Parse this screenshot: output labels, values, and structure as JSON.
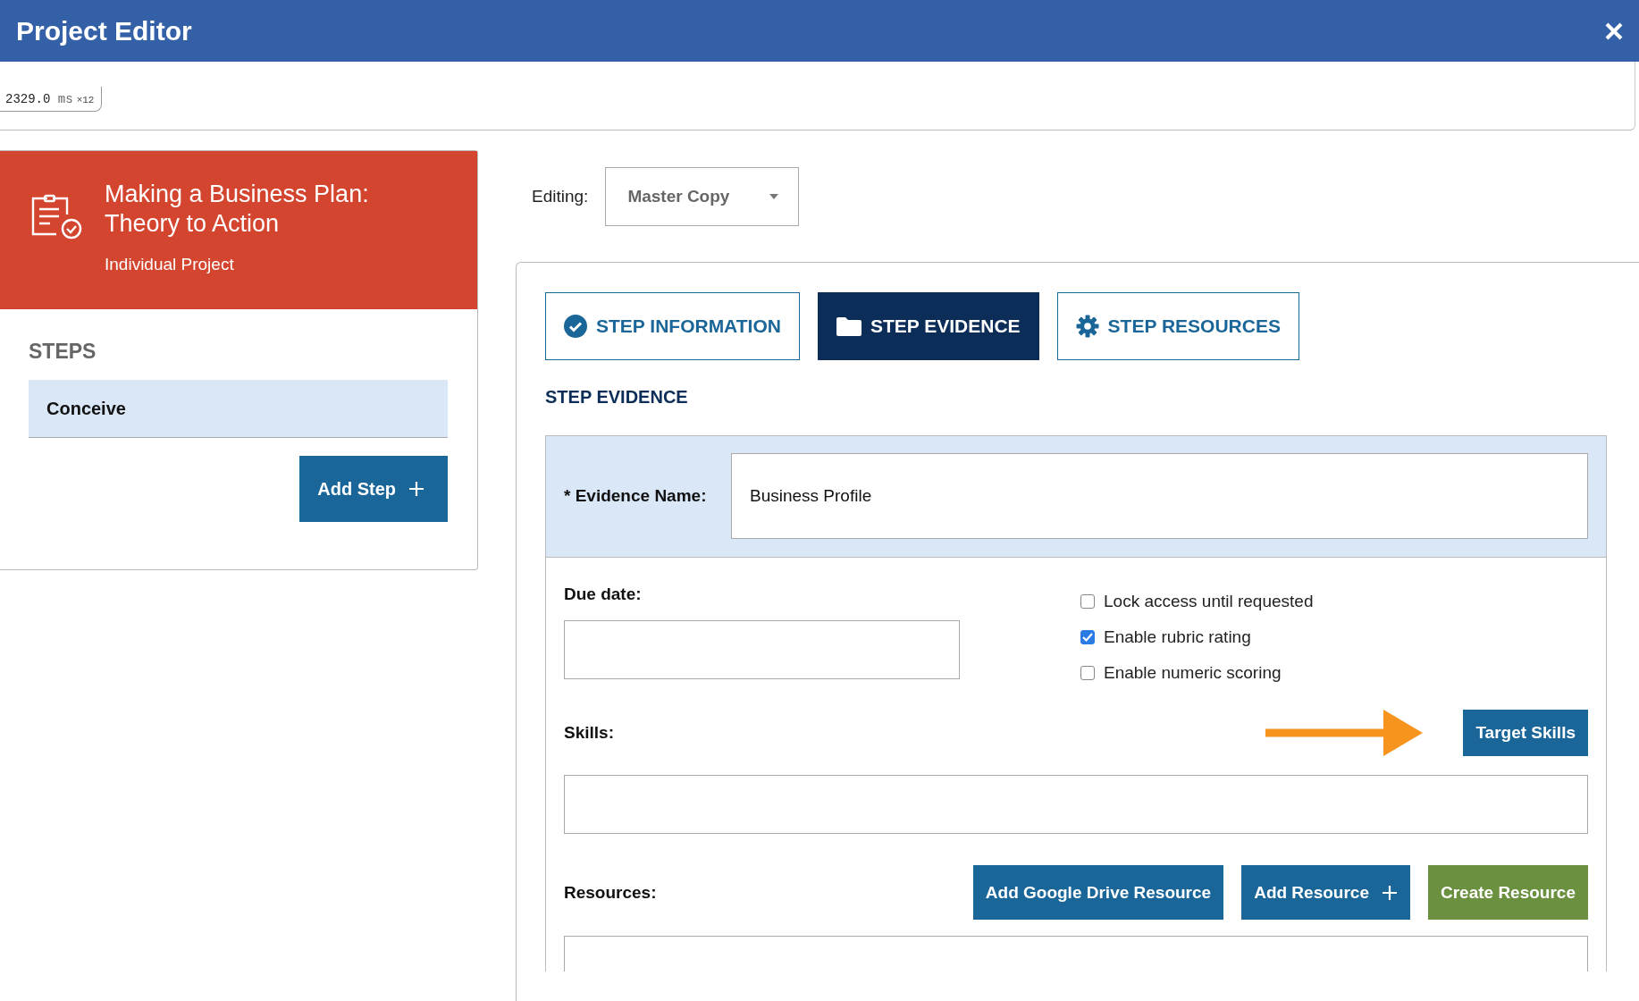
{
  "window": {
    "title": "Project Editor"
  },
  "timing": {
    "value": "2329.0",
    "unit": "ms",
    "count": "×12"
  },
  "project": {
    "title_line1": "Making a Business Plan:",
    "title_line2": "Theory to Action",
    "type": "Individual Project"
  },
  "steps": {
    "heading": "STEPS",
    "items": [
      {
        "label": "Conceive",
        "selected": true
      }
    ],
    "add_button": "Add Step"
  },
  "editing": {
    "label": "Editing:",
    "value": "Master Copy"
  },
  "tabs": [
    {
      "label": "STEP INFORMATION",
      "kind": "check",
      "selected": false
    },
    {
      "label": "STEP EVIDENCE",
      "kind": "folder",
      "selected": true
    },
    {
      "label": "STEP RESOURCES",
      "kind": "gear",
      "selected": false
    }
  ],
  "section_title": "STEP EVIDENCE",
  "evidence": {
    "name_label": "* Evidence Name:",
    "name_value": "Business Profile",
    "due_label": "Due date:",
    "options": [
      {
        "label": "Lock access until requested",
        "checked": false
      },
      {
        "label": "Enable rubric rating",
        "checked": true
      },
      {
        "label": "Enable numeric scoring",
        "checked": false
      }
    ],
    "skills_label": "Skills:",
    "target_button": "Target Skills",
    "resources_label": "Resources:",
    "resource_buttons": [
      {
        "label": "Add Google Drive Resource",
        "kind": "plain"
      },
      {
        "label": "Add Resource",
        "kind": "add"
      },
      {
        "label": "Create Resource",
        "kind": "create"
      }
    ]
  }
}
